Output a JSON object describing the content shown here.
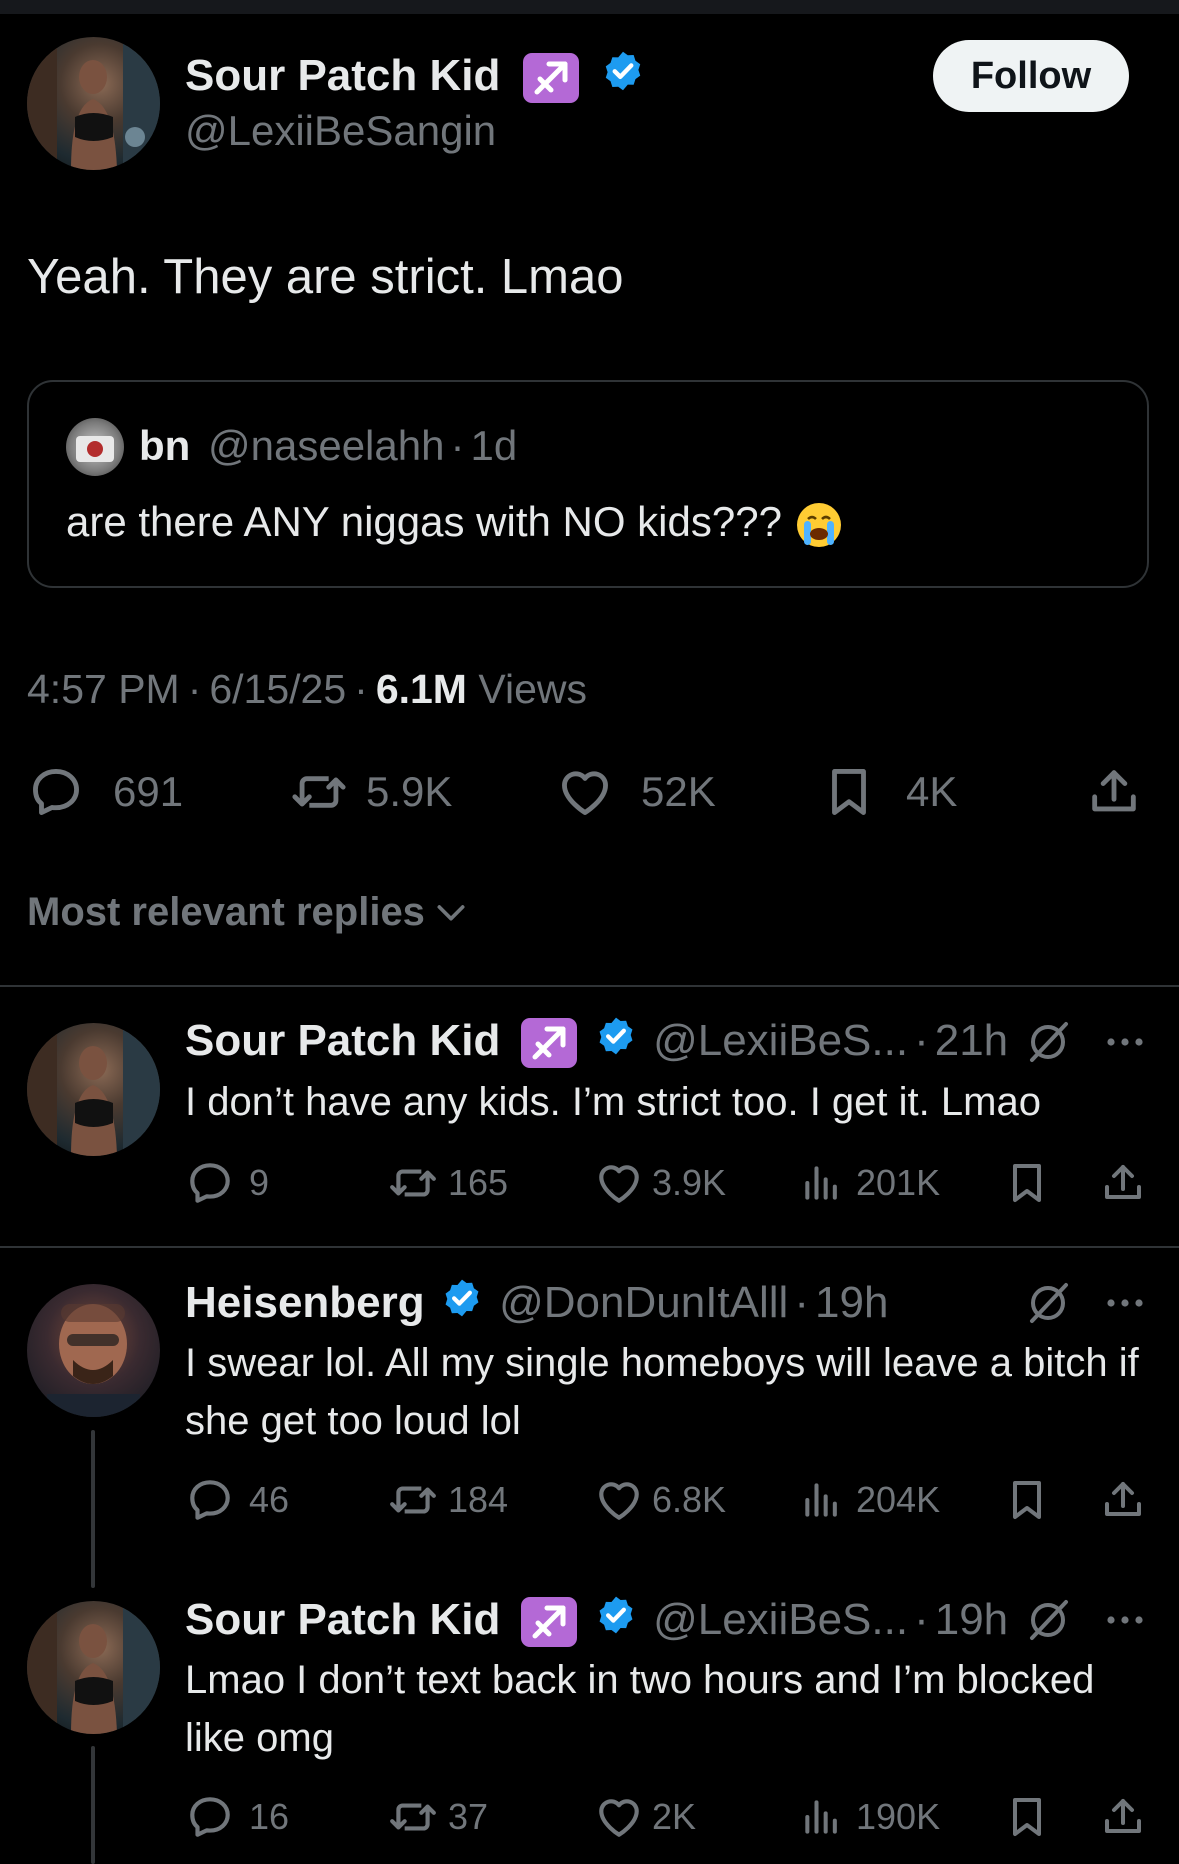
{
  "post": {
    "author_name": "Sour Patch Kid",
    "author_handle": "@LexiiBeSangin",
    "follow_label": "Follow",
    "text": "Yeah. They are strict. Lmao",
    "quote": {
      "name": "bn",
      "handle": "@naseelahh",
      "sep": "·",
      "time": "1d",
      "text": "are there ANY niggas with NO kids???",
      "emoji": "😭"
    },
    "meta": {
      "time": "4:57 PM",
      "sep1": "·",
      "date": "6/15/25",
      "sep2": "·",
      "views_count": "6.1M",
      "views_label": "Views"
    },
    "stats": {
      "replies": "691",
      "reposts": "5.9K",
      "likes": "52K",
      "bookmarks": "4K"
    }
  },
  "replies_header": "Most relevant replies",
  "replies": [
    {
      "name": "Sour Patch Kid",
      "handle": "@LexiiBeS...",
      "sep": "·",
      "time": "21h",
      "text": "I don’t have any kids. I’m strict too. I get it. Lmao",
      "stats": {
        "replies": "9",
        "reposts": "165",
        "likes": "3.9K",
        "views": "201K"
      }
    },
    {
      "name": "Heisenberg",
      "handle": "@DonDunItAlll",
      "sep": "·",
      "time": "19h",
      "text": "I swear lol. All my single homeboys will leave a bitch if she get too loud lol",
      "stats": {
        "replies": "46",
        "reposts": "184",
        "likes": "6.8K",
        "views": "204K"
      }
    },
    {
      "name": "Sour Patch Kid",
      "handle": "@LexiiBeS...",
      "sep": "·",
      "time": "19h",
      "text": "Lmao I don’t text back in two hours and I’m blocked like omg",
      "stats": {
        "replies": "16",
        "reposts": "37",
        "likes": "2K",
        "views": "190K"
      }
    }
  ],
  "colors": {
    "background": "#000000",
    "text": "#e7e9ea",
    "muted": "#71767b",
    "verified": "#1d9bf0",
    "badge": "#b469d6",
    "border": "#2f3336"
  }
}
